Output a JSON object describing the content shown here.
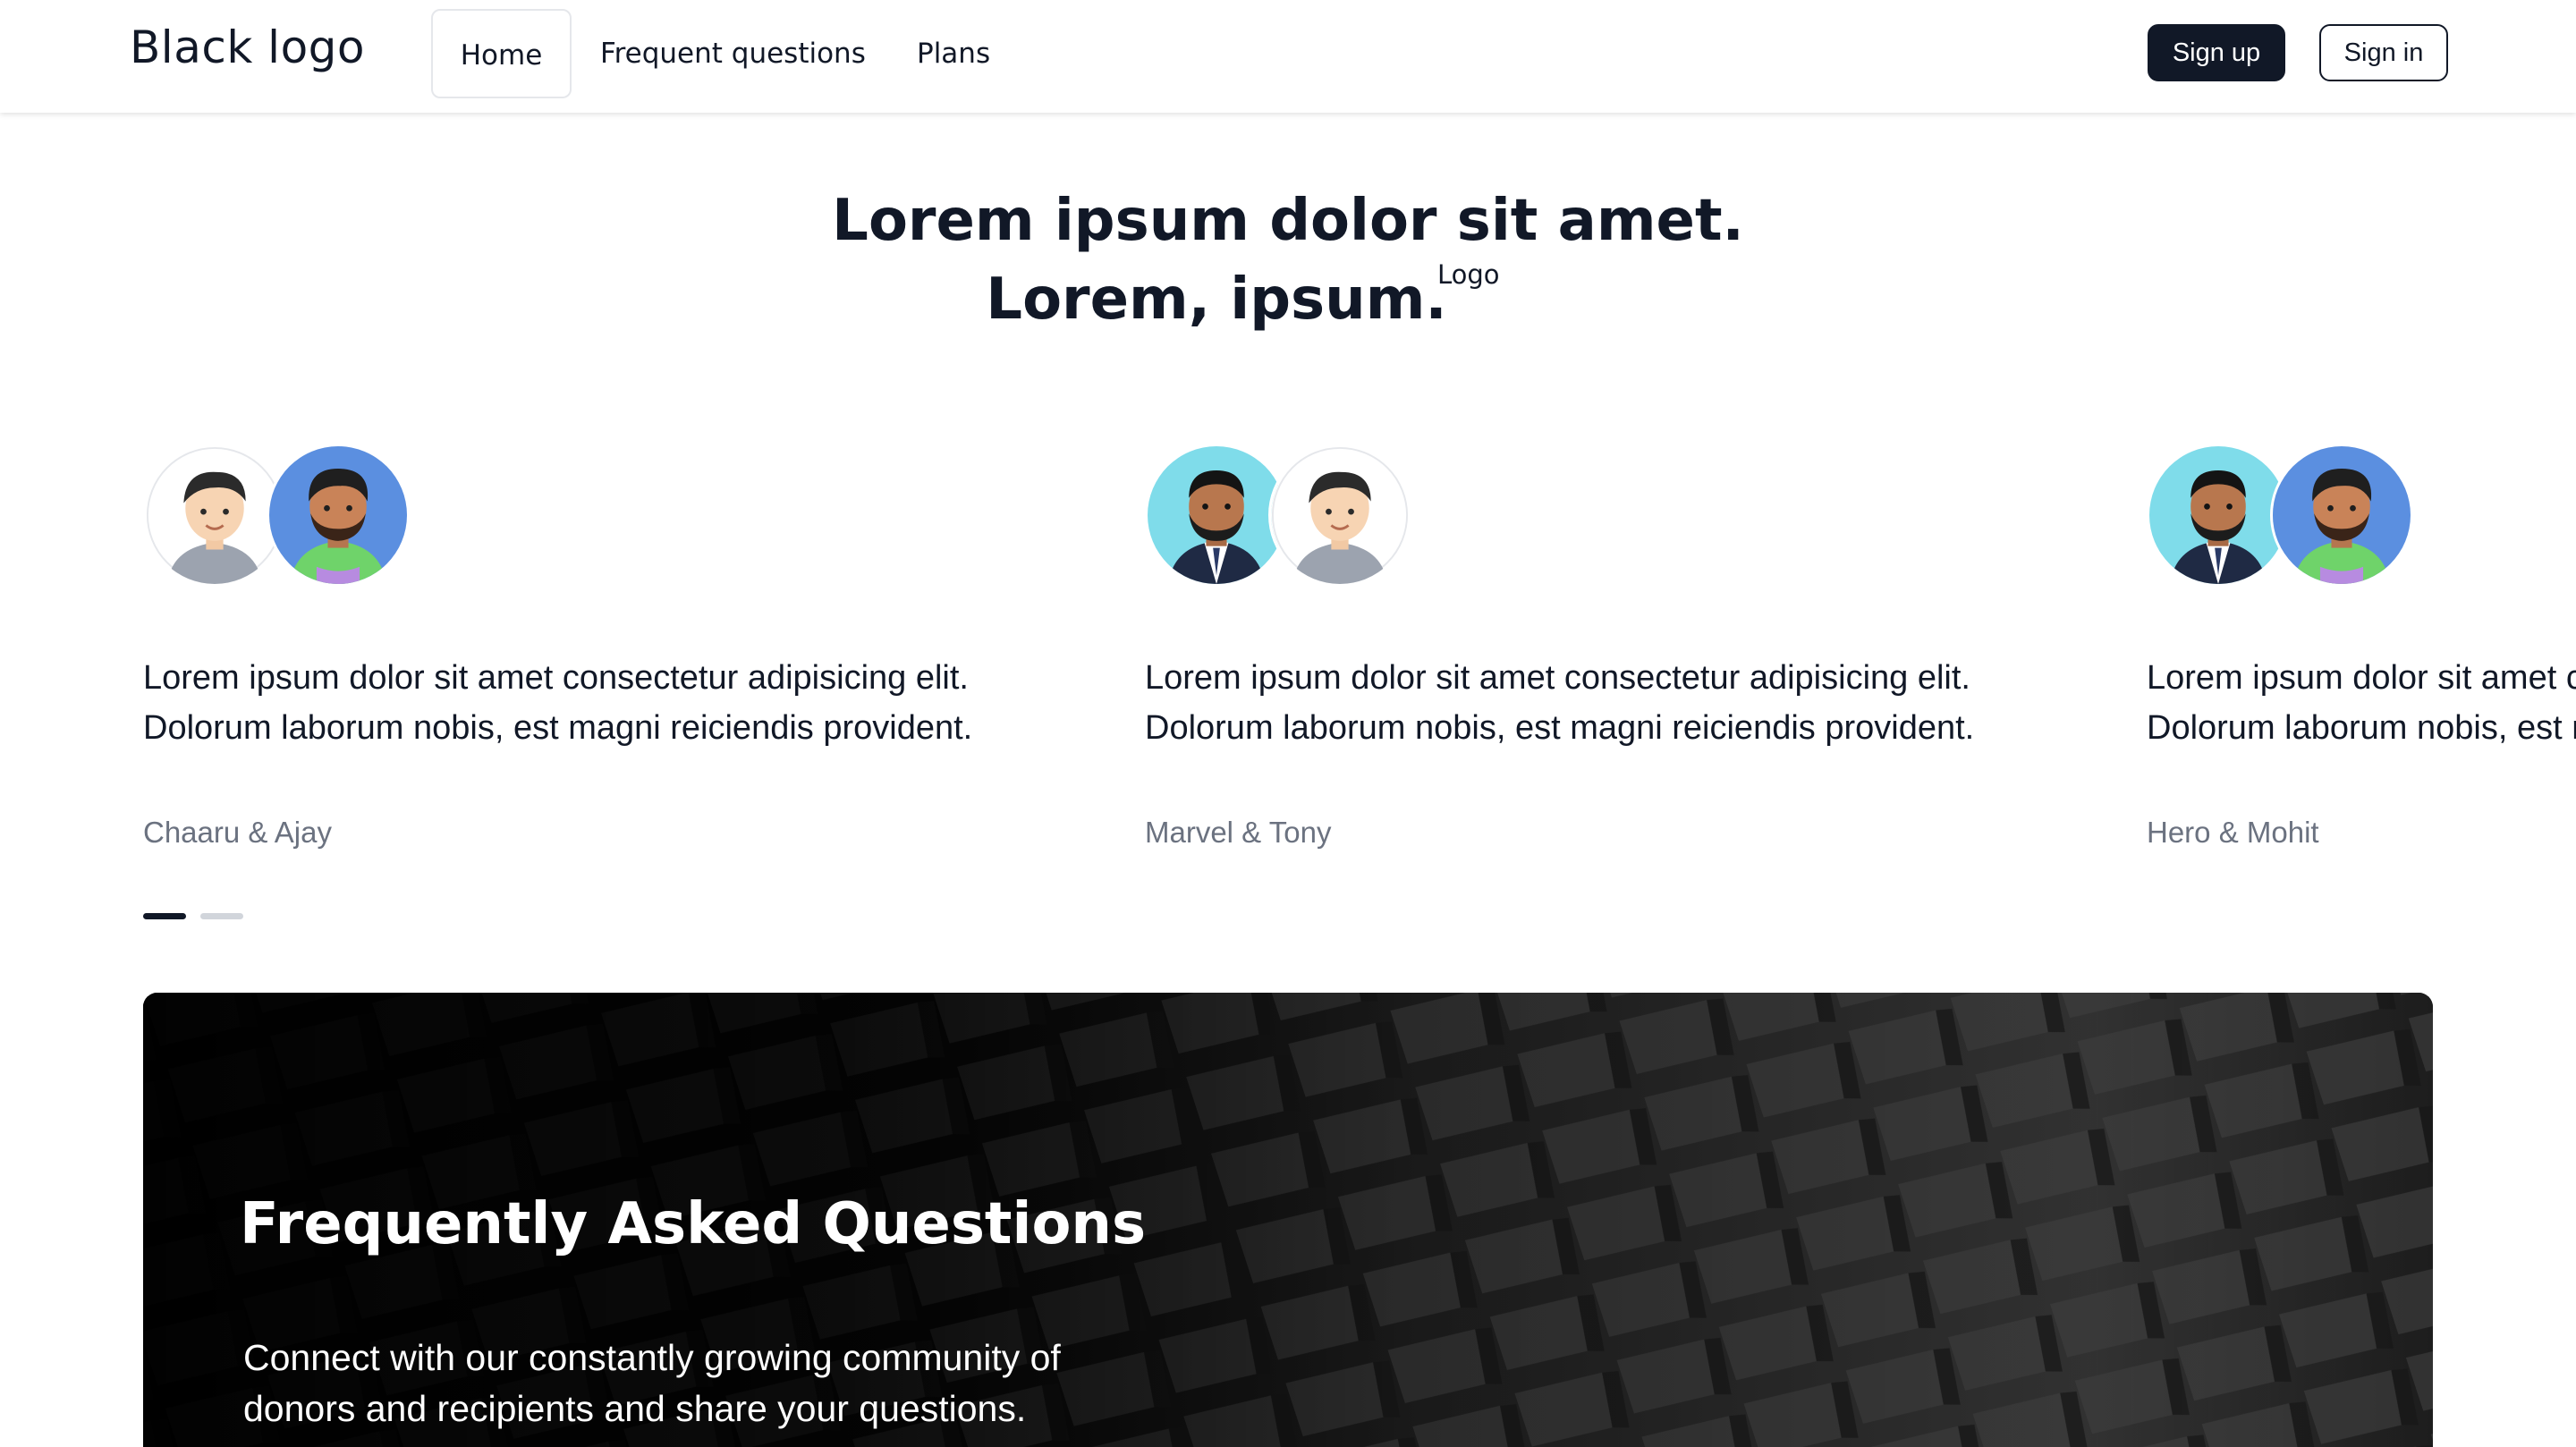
{
  "header": {
    "logo": "Black logo",
    "nav": [
      {
        "label": "Home",
        "active": true
      },
      {
        "label": "Frequent questions",
        "active": false
      },
      {
        "label": "Plans",
        "active": false
      }
    ],
    "signup_label": "Sign up",
    "signin_label": "Sign in"
  },
  "hero": {
    "line1": "Lorem ipsum dolor sit amet.",
    "line2": "Lorem, ipsum.",
    "sup": "Logo"
  },
  "testimonials": [
    {
      "line1": "Lorem ipsum dolor sit amet consectetur adipisicing elit.",
      "line2": "Dolorum laborum nobis, est magni reiciendis provident.",
      "author": "Chaaru & Ajay",
      "avatars": [
        "boy-avatar",
        "bearded-man-avatar"
      ]
    },
    {
      "line1": "Lorem ipsum dolor sit amet consectetur adipisicing elit.",
      "line2": "Dolorum laborum nobis, est magni reiciendis provident.",
      "author": "Marvel & Tony",
      "avatars": [
        "suited-man-avatar",
        "boy-avatar"
      ]
    },
    {
      "line1": "Lorem ipsum dolor sit amet consectetur adipisicing elit.",
      "line2": "Dolorum laborum nobis, est magni reiciendis provident.",
      "author": "Hero & Mohit",
      "avatars": [
        "suited-man-avatar",
        "bearded-man-avatar"
      ]
    }
  ],
  "carousel": {
    "pages": 2,
    "active": 1
  },
  "faq": {
    "title": "Frequently Asked Questions",
    "desc_line1": "Connect with our constantly growing community of",
    "desc_line2": "donors and recipients and share your questions."
  },
  "colors": {
    "primary": "#111827",
    "muted_text": "#6b7280",
    "avatar_blue": "#5b8fe0",
    "avatar_cyan": "#7fdcea",
    "avatar_light": "#ffffff"
  }
}
